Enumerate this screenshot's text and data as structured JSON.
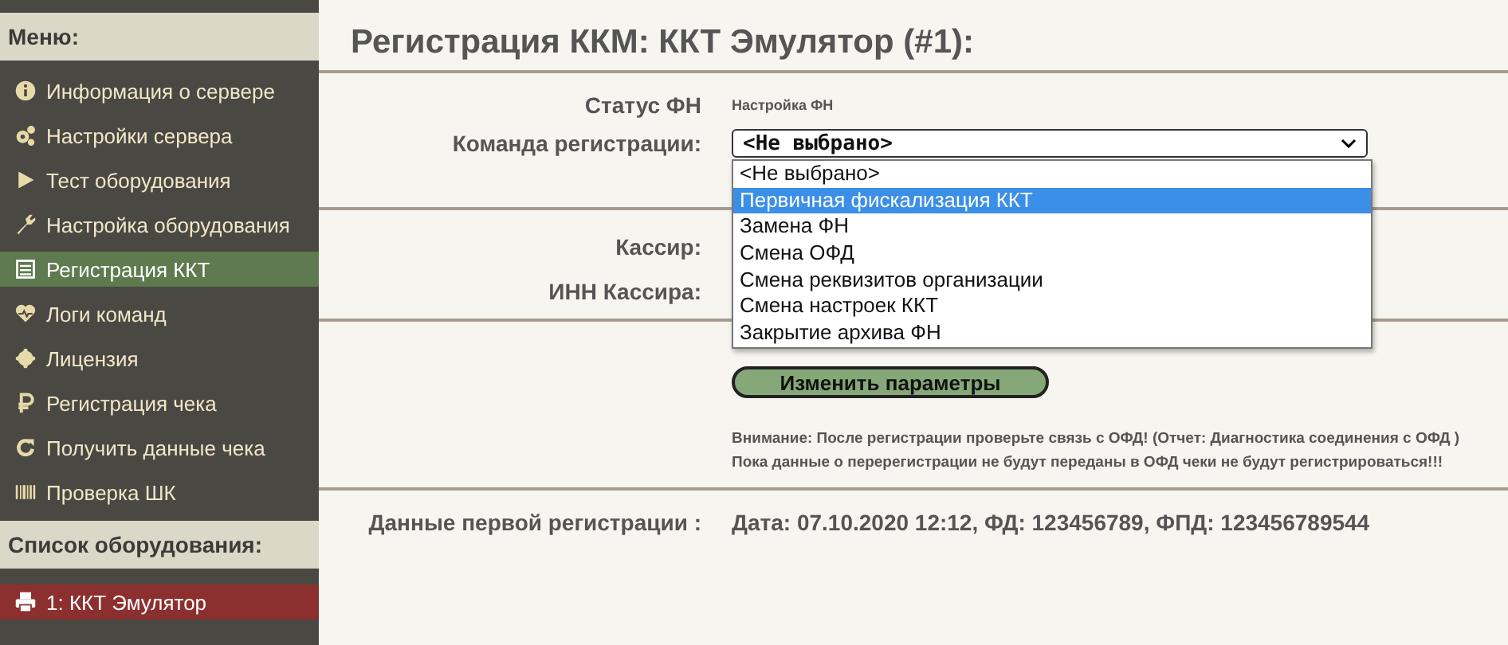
{
  "sidebar": {
    "menu_title": "Меню:",
    "menu_items": [
      {
        "label": "Информация о сервере",
        "selected": false
      },
      {
        "label": "Настройки сервера",
        "selected": false
      },
      {
        "label": "Тест оборудования",
        "selected": false
      },
      {
        "label": "Настройка оборудования",
        "selected": false
      },
      {
        "label": "Регистрация ККТ",
        "selected": true
      },
      {
        "label": "Логи команд",
        "selected": false
      },
      {
        "label": "Лицензия",
        "selected": false
      },
      {
        "label": "Регистрация чека",
        "selected": false
      },
      {
        "label": "Получить данные чека",
        "selected": false
      },
      {
        "label": "Проверка ШК",
        "selected": false
      }
    ],
    "equipment_title": "Список оборудования:",
    "equipment_items": [
      {
        "label": "1: ККТ Эмулятор",
        "selected": true
      }
    ]
  },
  "page_title": "Регистрация ККМ: ККТ Эмулятор (#1):",
  "fn_status": {
    "label": "Статус ФН",
    "value": "Настройка ФН"
  },
  "command": {
    "label": "Команда регистрации:",
    "value": "<Не выбрано>",
    "expanded": true,
    "options": [
      {
        "label": "<Не выбрано>",
        "highlighted": false
      },
      {
        "label": "Первичная фискализация ККТ",
        "highlighted": true
      },
      {
        "label": "Замена ФН",
        "highlighted": false
      },
      {
        "label": "Смена ОФД",
        "highlighted": false
      },
      {
        "label": "Смена реквизитов организации",
        "highlighted": false
      },
      {
        "label": "Смена настроек ККТ",
        "highlighted": false
      },
      {
        "label": "Закрытие архива ФН",
        "highlighted": false
      }
    ]
  },
  "cashier_labels": [
    "Кассир:",
    "ИНН Кассира:"
  ],
  "submit_button": "Изменить параметры",
  "notice": [
    "Внимание: После регистрации проверьте связь с ОФД! (Отчет: Диагностика соединения с ОФД )",
    "Пока данные о перерегистрации не будут переданы в ОФД чеки не будут регистрироваться!!!"
  ],
  "first_registration": {
    "label": "Данные первой регистрации :",
    "value": "Дата: 07.10.2020 12:12, ФД: 123456789, ФПД: 123456789544"
  }
}
